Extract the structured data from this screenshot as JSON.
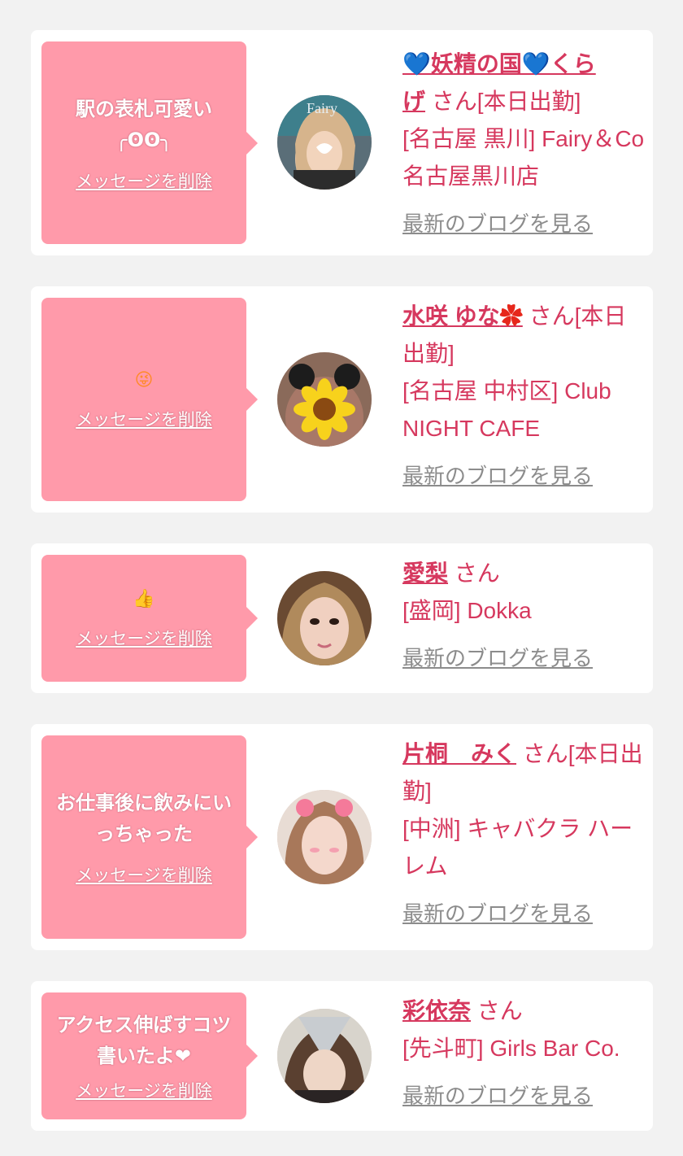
{
  "messages": [
    {
      "message_text": "駅の表札可愛い\n╭ʘʘ╮",
      "delete_label": "メッセージを削除",
      "name_part1": "💙妖精の国💙くら",
      "name_part2": "げ",
      "honorific": "さん[本日出勤]",
      "shop": "[名古屋 黒川] Fairy＆Co 名古屋黒川店",
      "blog_label": "最新のブログを見る",
      "avatar_icon": "avatar-photo-fairy"
    },
    {
      "message_text": "😜 ",
      "delete_label": "メッセージを削除",
      "name_part1": "水咲 ゆな",
      "name_part2": "✿",
      "honorific": "さん[本日出勤]",
      "shop": "[名古屋 中村区] Club NIGHT CAFE",
      "blog_label": "最新のブログを見る",
      "avatar_icon": "avatar-photo-sunflower"
    },
    {
      "message_text": "👍",
      "delete_label": "メッセージを削除",
      "name_part1": "愛梨",
      "name_part2": "",
      "honorific": "さん",
      "shop": "[盛岡] Dokka",
      "blog_label": "最新のブログを見る",
      "avatar_icon": "avatar-photo"
    },
    {
      "message_text": "お仕事後に飲みにいっちゃった",
      "delete_label": "メッセージを削除",
      "name_part1": "片桐　みく",
      "name_part2": "",
      "honorific": "さん[本日出勤]",
      "shop": "[中洲] キャバクラ ハーレム",
      "blog_label": "最新のブログを見る",
      "avatar_icon": "avatar-photo"
    },
    {
      "message_text": "アクセス伸ばすコツ書いたよ❤",
      "delete_label": "メッセージを削除",
      "name_part1": "彩依奈",
      "name_part2": "",
      "honorific": "さん",
      "shop": "[先斗町] Girls Bar Co.",
      "blog_label": "最新のブログを見る",
      "avatar_icon": "avatar-photo"
    }
  ],
  "colors": {
    "background": "#f2f2f2",
    "card": "#ffffff",
    "bubble": "#ff9aaa",
    "accent": "#d6385e",
    "link_gray": "#8c8c8c"
  }
}
